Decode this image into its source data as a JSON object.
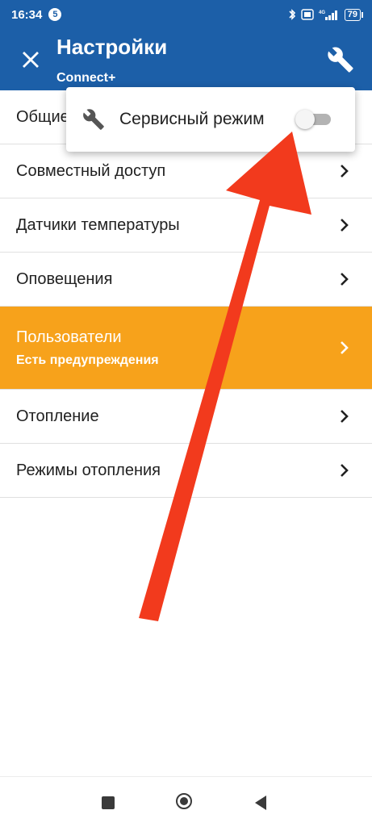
{
  "status_bar": {
    "time": "16:34",
    "notification_count": "5",
    "battery": "79",
    "network": "4G"
  },
  "app_bar": {
    "title": "Настройки",
    "subtitle": "Connect+"
  },
  "popup": {
    "label": "Сервисный режим",
    "toggle_on": false
  },
  "list": {
    "items": [
      {
        "label": "Общие"
      },
      {
        "label": "Совместный доступ"
      },
      {
        "label": "Датчики температуры"
      },
      {
        "label": "Оповещения"
      },
      {
        "label": "Пользователи",
        "sublabel": "Есть предупреждения",
        "highlighted": true
      },
      {
        "label": "Отопление"
      },
      {
        "label": "Режимы отопления"
      }
    ]
  },
  "colors": {
    "primary": "#1c5fa8",
    "warning": "#f7a21b",
    "annotation_arrow": "#f23a1d"
  },
  "icons": {
    "close": "close-icon",
    "wrench": "wrench-icon",
    "chevron": "chevron-right-icon"
  }
}
